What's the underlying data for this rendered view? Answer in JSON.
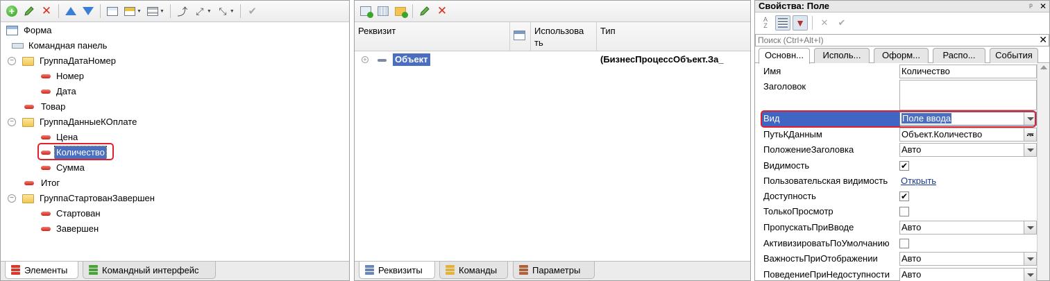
{
  "left_panel": {
    "tree": [
      {
        "label": "Форма",
        "icon": "form-icon",
        "level": 0
      },
      {
        "label": "Командная панель",
        "icon": "command-bar-icon",
        "level": 0
      },
      {
        "label": "ГруппаДатаНомер",
        "icon": "folder-icon",
        "level": 0,
        "collapsible": true
      },
      {
        "label": "Номер",
        "icon": "field-icon",
        "level": 1
      },
      {
        "label": "Дата",
        "icon": "field-icon",
        "level": 1
      },
      {
        "label": "Товар",
        "icon": "field-icon",
        "level": 0
      },
      {
        "label": "ГруппаДанныеКОплате",
        "icon": "folder-icon",
        "level": 0,
        "collapsible": true
      },
      {
        "label": "Цена",
        "icon": "field-icon",
        "level": 1
      },
      {
        "label": "Количество",
        "icon": "field-icon",
        "level": 1,
        "selected": true
      },
      {
        "label": "Сумма",
        "icon": "field-icon",
        "level": 1
      },
      {
        "label": "Итог",
        "icon": "field-icon",
        "level": 0
      },
      {
        "label": "ГруппаСтартованЗавершен",
        "icon": "folder-icon",
        "level": 0,
        "collapsible": true
      },
      {
        "label": "Стартован",
        "icon": "field-icon",
        "level": 1
      },
      {
        "label": "Завершен",
        "icon": "field-icon",
        "level": 1
      }
    ],
    "tabs": {
      "elements": "Элементы",
      "command_interface": "Командный интерфейс"
    }
  },
  "mid_panel": {
    "columns": {
      "attribute": "Реквизит",
      "use": "Использова\nть",
      "type": "Тип"
    },
    "row": {
      "name": "Объект",
      "type": "(БизнесПроцессОбъект.За_"
    },
    "tabs": {
      "attributes": "Реквизиты",
      "commands": "Команды",
      "parameters": "Параметры"
    }
  },
  "right_panel": {
    "title": "Свойства: Поле",
    "title_pin": "ᵖ",
    "title_close": "✕",
    "search_placeholder": "Поиск (Ctrl+Alt+I)",
    "search_clear": "✕",
    "tabs": {
      "main": "Основн...",
      "use": "Исполь...",
      "design": "Оформ...",
      "layout": "Распо...",
      "events": "События"
    },
    "props": {
      "name": {
        "label": "Имя",
        "value": "Количество"
      },
      "title": {
        "label": "Заголовок",
        "value": ""
      },
      "kind": {
        "label": "Вид",
        "value": "Поле ввода"
      },
      "data_path": {
        "label": "ПутьКДанным",
        "value": "Объект.Количество"
      },
      "title_location": {
        "label": "ПоложениеЗаголовка",
        "value": "Авто"
      },
      "visible": {
        "label": "Видимость",
        "checked": "✔"
      },
      "user_visible": {
        "label": "Пользовательская видимость",
        "link": "Открыть"
      },
      "enabled": {
        "label": "Доступность",
        "checked": "✔"
      },
      "read_only": {
        "label": "ТолькоПросмотр",
        "checked": ""
      },
      "skip_on_input": {
        "label": "ПропускатьПриВводе",
        "value": "Авто"
      },
      "activate_default": {
        "label": "АктивизироватьПоУмолчанию",
        "checked": ""
      },
      "display_importance": {
        "label": "ВажностьПриОтображении",
        "value": "Авто"
      },
      "unavailable_behavior": {
        "label": "ПоведениеПриНедоступности",
        "value": "Авто"
      }
    },
    "ellipsis": "..."
  },
  "colors": {
    "selection": "#4a6fc0",
    "highlight_frame": "#e0202c"
  }
}
